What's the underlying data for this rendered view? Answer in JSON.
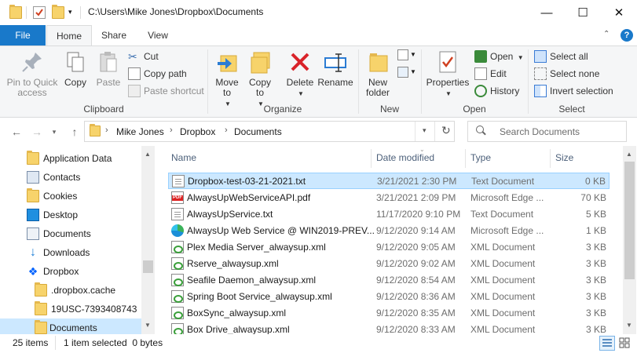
{
  "window": {
    "path": "C:\\Users\\Mike Jones\\Dropbox\\Documents",
    "minimize": "—",
    "maximize": "☐",
    "close": "✕"
  },
  "tabs": {
    "file": "File",
    "home": "Home",
    "share": "Share",
    "view": "View"
  },
  "ribbon": {
    "clipboard": {
      "pin": "Pin to Quick access",
      "copy": "Copy",
      "paste": "Paste",
      "cut": "Cut",
      "copy_path": "Copy path",
      "paste_shortcut": "Paste shortcut",
      "label": "Clipboard"
    },
    "organize": {
      "move_to": "Move to",
      "copy_to": "Copy to",
      "delete": "Delete",
      "rename": "Rename",
      "label": "Organize"
    },
    "new": {
      "new_folder": "New folder",
      "label": "New"
    },
    "open": {
      "properties": "Properties",
      "open": "Open",
      "edit": "Edit",
      "history": "History",
      "label": "Open"
    },
    "select": {
      "select_all": "Select all",
      "select_none": "Select none",
      "invert": "Invert selection",
      "label": "Select"
    }
  },
  "address": {
    "crumbs": [
      "Mike Jones",
      "Dropbox",
      "Documents"
    ],
    "search_placeholder": "Search Documents"
  },
  "nav": [
    {
      "label": "Application Data",
      "icon": "shortcut-folder-icon"
    },
    {
      "label": "Contacts",
      "icon": "contacts-icon"
    },
    {
      "label": "Cookies",
      "icon": "folder-icon"
    },
    {
      "label": "Desktop",
      "icon": "desktop-icon"
    },
    {
      "label": "Documents",
      "icon": "documents-icon"
    },
    {
      "label": "Downloads",
      "icon": "downloads-icon"
    },
    {
      "label": "Dropbox",
      "icon": "dropbox-icon"
    },
    {
      "label": ".dropbox.cache",
      "icon": "folder-icon"
    },
    {
      "label": "19USC-7393408743",
      "icon": "sync-folder-icon"
    },
    {
      "label": "Documents",
      "icon": "sync-folder-icon"
    }
  ],
  "columns": {
    "name": "Name",
    "date": "Date modified",
    "type": "Type",
    "size": "Size"
  },
  "files": [
    {
      "name": "Dropbox-test-03-21-2021.txt",
      "date": "3/21/2021 2:30 PM",
      "type": "Text Document",
      "size": "0 KB",
      "icon": "text-file-icon"
    },
    {
      "name": "AlwaysUpWebServiceAPI.pdf",
      "date": "3/21/2021 2:09 PM",
      "type": "Microsoft Edge ...",
      "size": "70 KB",
      "icon": "pdf-file-icon"
    },
    {
      "name": "AlwaysUpService.txt",
      "date": "11/17/2020 9:10 PM",
      "type": "Text Document",
      "size": "5 KB",
      "icon": "text-file-icon"
    },
    {
      "name": "AlwaysUp Web Service @ WIN2019-PREV...",
      "date": "9/12/2020 9:14 AM",
      "type": "Microsoft Edge ...",
      "size": "1 KB",
      "icon": "edge-icon"
    },
    {
      "name": "Plex Media Server_alwaysup.xml",
      "date": "9/12/2020 9:05 AM",
      "type": "XML Document",
      "size": "3 KB",
      "icon": "xml-file-icon"
    },
    {
      "name": "Rserve_alwaysup.xml",
      "date": "9/12/2020 9:02 AM",
      "type": "XML Document",
      "size": "3 KB",
      "icon": "xml-file-icon"
    },
    {
      "name": "Seafile Daemon_alwaysup.xml",
      "date": "9/12/2020 8:54 AM",
      "type": "XML Document",
      "size": "3 KB",
      "icon": "xml-file-icon"
    },
    {
      "name": "Spring Boot Service_alwaysup.xml",
      "date": "9/12/2020 8:36 AM",
      "type": "XML Document",
      "size": "3 KB",
      "icon": "xml-file-icon"
    },
    {
      "name": "BoxSync_alwaysup.xml",
      "date": "9/12/2020 8:35 AM",
      "type": "XML Document",
      "size": "3 KB",
      "icon": "xml-file-icon"
    },
    {
      "name": "Box Drive_alwaysup.xml",
      "date": "9/12/2020 8:33 AM",
      "type": "XML Document",
      "size": "3 KB",
      "icon": "xml-file-icon"
    }
  ],
  "status": {
    "count": "25 items",
    "selected": "1 item selected  0 bytes"
  },
  "colors": {
    "accent": "#1979ca",
    "selection": "#cce8ff"
  }
}
